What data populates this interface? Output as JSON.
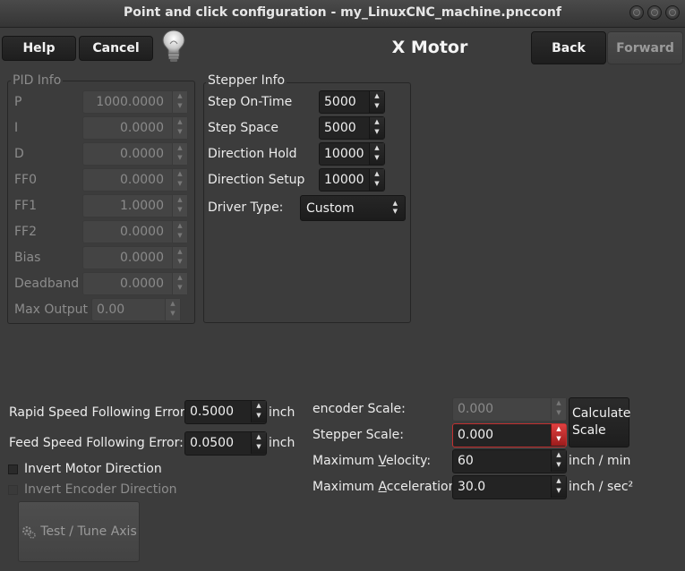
{
  "window": {
    "title": "Point and click configuration - my_LinuxCNC_machine.pncconf"
  },
  "toolbar": {
    "help_label": "Help",
    "cancel_label": "Cancel",
    "page_title": "X Motor",
    "back_label": "Back",
    "forward_label": "Forward"
  },
  "pid": {
    "frame_label": "PID Info",
    "rows": [
      {
        "label": "P",
        "value": "1000.0000"
      },
      {
        "label": "I",
        "value": "0.0000"
      },
      {
        "label": "D",
        "value": "0.0000"
      },
      {
        "label": "FF0",
        "value": "0.0000"
      },
      {
        "label": "FF1",
        "value": "1.0000"
      },
      {
        "label": "FF2",
        "value": "0.0000"
      },
      {
        "label": "Bias",
        "value": "0.0000"
      },
      {
        "label": "Deadband",
        "value": "0.0000"
      }
    ],
    "max_output_label": "Max Output",
    "max_output_value": "0.00"
  },
  "stepper": {
    "frame_label": "Stepper Info",
    "on_time_label": "Step On-Time",
    "on_time_value": "5000",
    "space_label": "Step Space",
    "space_value": "5000",
    "dir_hold_label": "Direction Hold",
    "dir_hold_value": "10000",
    "dir_setup_label": "Direction Setup",
    "dir_setup_value": "10000",
    "driver_label": "Driver Type:",
    "driver_value": "Custom"
  },
  "following": {
    "rapid_label": "Rapid Speed Following Error:",
    "rapid_value": "0.5000",
    "rapid_unit": "inch",
    "feed_label": "Feed Speed Following Error:",
    "feed_value": "0.0500",
    "feed_unit": "inch"
  },
  "options": {
    "invert_motor_label": "Invert Motor Direction",
    "invert_encoder_label": "Invert Encoder Direction",
    "test_tune_label": "Test / Tune Axis"
  },
  "scale": {
    "encoder_label": "encoder Scale:",
    "encoder_value": "0.000",
    "stepper_label": "Stepper Scale:",
    "stepper_value": "0.000",
    "calc_line1": "Calculate",
    "calc_line2": "Scale"
  },
  "motion": {
    "velocity_label_pre": "Maximum ",
    "velocity_label_u": "V",
    "velocity_label_post": "elocity:",
    "velocity_value": "60",
    "velocity_unit": "inch / min",
    "accel_label_pre": "Maximum ",
    "accel_label_u": "A",
    "accel_label_post": "cceleration:",
    "accel_value": "30.0",
    "accel_unit": "inch / sec²"
  },
  "colors": {
    "background": "#3c3c3c",
    "error_red": "#c23030"
  }
}
